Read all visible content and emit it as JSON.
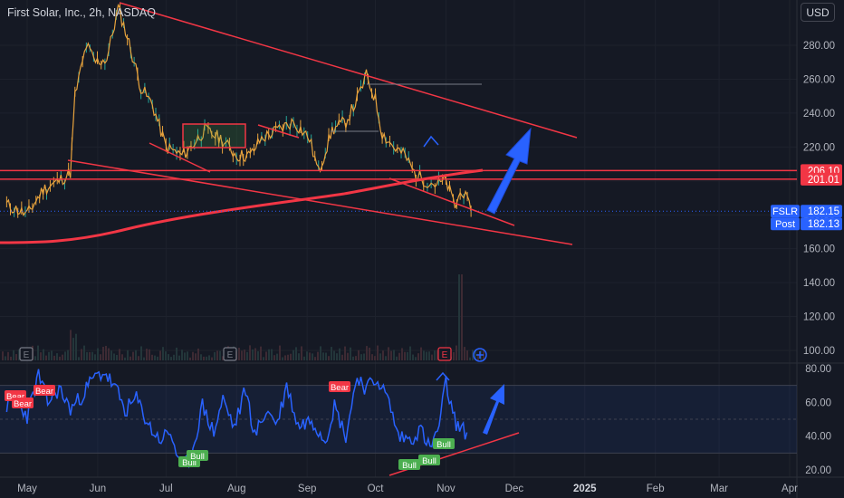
{
  "header": {
    "title": "First Solar, Inc., 2h, NASDAQ",
    "currency_button": "USD"
  },
  "colors": {
    "background": "#151924",
    "grid": "#1e222d",
    "axis_text": "#b2b5be",
    "price_line": "#e8a33d",
    "red_line": "#f23645",
    "rsi_line": "#2962ff",
    "arrow_blue": "#2962ff",
    "bull": "#4caf50",
    "bear": "#f23645",
    "price_label": "#2962ff"
  },
  "price_labels": [
    {
      "text": "206.10",
      "sub": "",
      "color": "#f23645"
    },
    {
      "text": "201.01",
      "sub": "",
      "color": "#f23645"
    },
    {
      "text": "182.15",
      "sub": "FSLR",
      "color": "#2962ff"
    },
    {
      "text": "182.13",
      "sub": "Post",
      "color": "#2962ff"
    }
  ],
  "event_markers": [
    "E",
    "E",
    "E"
  ],
  "signals": [
    "Bear",
    "Bear",
    "Bear",
    "Bear",
    "Bull",
    "Bull",
    "Bull",
    "Bull",
    "Bull"
  ],
  "chart_data": [
    {
      "type": "line",
      "name_hint": "price",
      "x_ticks": [
        "May",
        "Jun",
        "Jul",
        "Aug",
        "Sep",
        "Oct",
        "Nov",
        "Dec",
        "2025",
        "Feb",
        "Mar",
        "Apr"
      ],
      "ylim": [
        95,
        300
      ],
      "y_ticks": [
        100,
        120,
        140,
        160,
        180,
        200,
        220,
        240,
        260,
        280
      ],
      "y_tick_labels": [
        "100.00",
        "120.00",
        "140.00",
        "160.00",
        "180.00",
        "200.00",
        "220.00",
        "240.00",
        "260.00",
        "280.00"
      ],
      "horizontal_levels": [
        206.1,
        201.01
      ],
      "last_price": 182.15,
      "post_price": 182.13,
      "series": [
        {
          "x": [
            "2024-04-22",
            "2024-05-01",
            "2024-05-08",
            "2024-05-15",
            "2024-05-20",
            "2024-05-22",
            "2024-05-27",
            "2024-05-31",
            "2024-06-05",
            "2024-06-10",
            "2024-06-14",
            "2024-06-17",
            "2024-06-20",
            "2024-06-25",
            "2024-07-01",
            "2024-07-08",
            "2024-07-12",
            "2024-07-18",
            "2024-07-25",
            "2024-08-01",
            "2024-08-07",
            "2024-08-12",
            "2024-08-19",
            "2024-08-26",
            "2024-09-02",
            "2024-09-06",
            "2024-09-12",
            "2024-09-18",
            "2024-09-23",
            "2024-09-27",
            "2024-10-01",
            "2024-10-04",
            "2024-10-09",
            "2024-10-14",
            "2024-10-18",
            "2024-10-23",
            "2024-10-28",
            "2024-11-01",
            "2024-11-05",
            "2024-11-08",
            "2024-11-12"
          ],
          "y": [
            186,
            180,
            195,
            200,
            205,
            250,
            280,
            270,
            272,
            302,
            285,
            270,
            255,
            245,
            220,
            215,
            220,
            230,
            225,
            215,
            215,
            225,
            230,
            235,
            225,
            205,
            230,
            235,
            248,
            262,
            248,
            228,
            220,
            215,
            205,
            200,
            198,
            200,
            185,
            195,
            182
          ]
        }
      ]
    },
    {
      "type": "line",
      "name_hint": "oscillator",
      "ylim": [
        17,
        82
      ],
      "y_ticks": [
        20,
        40,
        60,
        80
      ],
      "y_tick_labels": [
        "20.00",
        "40.00",
        "60.00",
        "80.00"
      ],
      "bands": [
        30,
        50,
        70
      ],
      "series": [
        {
          "x": [
            "2024-04-22",
            "2024-04-26",
            "2024-05-01",
            "2024-05-06",
            "2024-05-10",
            "2024-05-15",
            "2024-05-20",
            "2024-05-24",
            "2024-05-30",
            "2024-06-04",
            "2024-06-10",
            "2024-06-13",
            "2024-06-18",
            "2024-06-24",
            "2024-06-28",
            "2024-07-03",
            "2024-07-08",
            "2024-07-12",
            "2024-07-17",
            "2024-07-22",
            "2024-07-26",
            "2024-07-31",
            "2024-08-05",
            "2024-08-09",
            "2024-08-14",
            "2024-08-19",
            "2024-08-23",
            "2024-08-28",
            "2024-09-03",
            "2024-09-09",
            "2024-09-13",
            "2024-09-18",
            "2024-09-23",
            "2024-09-27",
            "2024-10-02",
            "2024-10-07",
            "2024-10-11",
            "2024-10-16",
            "2024-10-21",
            "2024-10-25",
            "2024-10-29",
            "2024-11-01",
            "2024-11-04",
            "2024-11-07",
            "2024-11-11"
          ],
          "y": [
            58,
            62,
            52,
            76,
            60,
            68,
            56,
            62,
            74,
            78,
            65,
            55,
            62,
            45,
            38,
            42,
            20,
            28,
            58,
            42,
            62,
            45,
            68,
            40,
            55,
            48,
            70,
            46,
            50,
            38,
            58,
            40,
            76,
            68,
            74,
            60,
            40,
            38,
            44,
            32,
            46,
            72,
            52,
            44,
            42
          ]
        }
      ]
    }
  ]
}
